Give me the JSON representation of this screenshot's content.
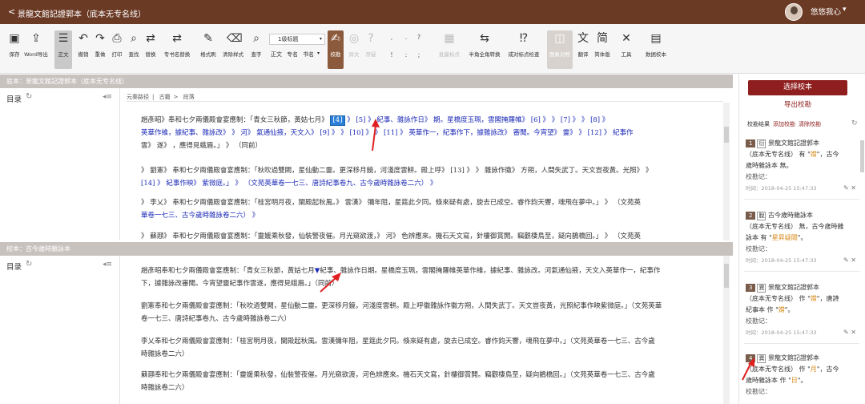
{
  "titlebar": {
    "back": "<",
    "title": "景龍文館記證郭本（底本无专名线）",
    "user": "悠悠我心",
    "caret": "▾"
  },
  "toolbar": {
    "buttons": [
      {
        "label": "保存",
        "icon": "save-icon",
        "glyph": "▣"
      },
      {
        "label": "Word导出",
        "icon": "word-export-icon",
        "glyph": "⇪"
      },
      {
        "label": "正文",
        "icon": "text-icon",
        "glyph": "☰"
      },
      {
        "label": "撤销",
        "icon": "undo-icon",
        "glyph": "↶"
      },
      {
        "label": "重做",
        "icon": "redo-icon",
        "glyph": "↷"
      },
      {
        "label": "打印",
        "icon": "print-icon",
        "glyph": "⎙"
      },
      {
        "label": "查找",
        "icon": "find-icon",
        "glyph": "⌕"
      },
      {
        "label": "替换",
        "icon": "replace-icon",
        "glyph": "⇄"
      },
      {
        "label": "专书名替换",
        "icon": "book-replace-icon",
        "glyph": "⇄"
      },
      {
        "label": "格式刷",
        "icon": "format-brush-icon",
        "glyph": "✎"
      },
      {
        "label": "清除样式",
        "icon": "clear-style-icon",
        "glyph": "⌫"
      },
      {
        "label": "查字",
        "icon": "lookup-char-icon",
        "glyph": "⌕"
      },
      {
        "label": "校勘",
        "icon": "collate-icon",
        "glyph": "✍"
      },
      {
        "label": "异文",
        "icon": "variant-icon",
        "glyph": "◎"
      },
      {
        "label": "存疑",
        "icon": "doubt-icon",
        "glyph": "?"
      },
      {
        "label": "批量标点",
        "icon": "batch-punct-icon",
        "glyph": "▦"
      },
      {
        "label": "半角全角转换",
        "icon": "width-convert-icon",
        "glyph": "⇆"
      },
      {
        "label": "成对标点检查",
        "icon": "pair-punct-icon",
        "glyph": "⁉"
      },
      {
        "label": "图象对照",
        "icon": "image-compare-icon",
        "glyph": "◫"
      },
      {
        "label": "翻译",
        "icon": "translate-icon",
        "glyph": "文"
      },
      {
        "label": "简体版",
        "icon": "simplified-icon",
        "glyph": "简"
      },
      {
        "label": "工具",
        "icon": "tools-icon",
        "glyph": "✕"
      },
      {
        "label": "数据校本",
        "icon": "data-collate-icon",
        "glyph": "▤"
      }
    ],
    "heading_select": "1级标题",
    "format_labels": [
      "正文",
      "专名",
      "书名"
    ]
  },
  "top_panel": {
    "head": "底本：景龍文館記證郭本（底本无专名线）",
    "toc_label": "目录",
    "breadcrumb": [
      "元秦路径",
      "古籍",
      "段落"
    ],
    "paras": [
      {
        "l1": "趙彥昭》奉和七夕兩儀殿會宴應制：「青女三秋節，黃姑七月》",
        "mark4": "[4]",
        "l1b": "》 [5] 》 紀事、雜詠作日》 期。星橋度玉珮，雲閣掩羅帷》 [6] 》 》 [7] 》 》 [8] 》",
        "l2": "英華作維，據紀事、雜詠改》 》 河》 氣通仙掖，天文入》 [9] 》 》 [10] 》 》 [11] 》 英華作一，紀事作下，據雜詠改》 審聞。今宵望》 靈》 》 [12] 》 紀事作",
        "l3": "雲》 遂》 ，應得見蛾眉。」 》 （同前）"
      },
      {
        "l1": "》 劉憲》 奉和七夕兩儀殿會宴應制：「秋吹過雙闕，星仙動二靈。更深移月鏡，河淺度雲軿。殿上呼》 [13] 》 》 雜詠作徽》 方朔，人間失武丁。天文豈夜黃。光照》 》",
        "l2": "[14] 》 紀事作映》 紫微庭。」 》 （文苑英華卷一七三、唐詩紀事卷九、古今歲時雜詠卷二六） 》"
      },
      {
        "l1": "》 李乂》 奉和七夕兩儀殿會宴應制：「桂宮明月夜，闌殿起秋風。》 雲漢》 彌年阻，星筵此夕同。倏來疑有處，旋去已成空。睿作鈞天響，魂飛在夢中。」 》 （文苑英",
        "l2": "華卷一七三、古今歲時雜詠卷二六） 》"
      },
      {
        "l1": "》 蘇頲》 奉和七夕兩儀殿會宴應制：「靈媛乘秋發，仙裝警夜催。月光窺欲渡，》 河》 色辨應來。機石天文寫，針樓御賞開。竊觀棲鳥至，疑向鵲橋回。」 》 （文苑英"
      }
    ]
  },
  "bottom_panel": {
    "head": "校本：古今歲時雜詠本",
    "toc_label": "目录",
    "paras": [
      {
        "l1": "趙彥昭奉和七夕兩儀殿會宴應制：「青女三秋節，黃姑七月",
        "l1b": "紀事、雜詠作日期。星橋度玉珮，雲閣掩羅帷英華作維，據紀事、雜詠改。河氣通仙掖，天文入英華作一，紀事作",
        "l2": "下，據雜詠改審聞。今宵望靈紀事作雲遂，應得見蛾眉。」（同前）"
      },
      {
        "l1": "劉憲奉和七夕兩儀殿會宴應制：「秋吹過雙闕，星仙動二靈。更深移月鏡，河淺度雲軿。殿上呼徽雜詠作徽方朔，人間失武丁。天文豈夜黃，光照紀事作映紫微庭。」（文苑英華",
        "l2": "卷一七三、唐詩紀事卷九、古今歲時雜詠卷二六）"
      },
      {
        "l1": "李乂奉和七夕兩儀殿會宴應制：「桂宮明月夜，闌殿起秋風。雲漢彌年阻，星筵此夕同。倏來疑有處，旋去已成空。睿作鈞天響，魂飛在夢中。」（文苑英華卷一七三、古今歲",
        "l2": "時雜詠卷二六）"
      },
      {
        "l1": "蘇頲奉和七夕兩儀殿會宴應制：「靈媛乘秋發，仙裝警夜催。月光窺欲渡，河色辨應來。機石天文寫，針樓御賞開。竊觀棲鳥至，疑向鵲橋回。」（文苑英華卷一七三、古今歲",
        "l2": "時雜詠卷二六）"
      }
    ]
  },
  "right_panel": {
    "select_button": "选择校本",
    "export_link": "导出校勘",
    "tabs": [
      "校勘结果",
      "添加校勘",
      "清除校勘"
    ],
    "cards": [
      {
        "num": "1",
        "type": "衍",
        "t1": "景龍文館記證郭本",
        "t2": "（底本无专名线） 有 \"",
        "hl": "嫦",
        "t3": "\"，古今",
        "t4": "歲時雜詠本 無。",
        "note": "校勘记：",
        "time": "时间：2018-04-25 15:47:33"
      },
      {
        "num": "2",
        "type": "脫",
        "t1": "古今歲時雜詠本",
        "t2": "（底本无专名线） 無，古今歲時雜",
        "t3": "詠本 有 \"",
        "hl": "星昇疑闕",
        "t4": "\"。",
        "note": "校勘记：",
        "time": "时间：2018-04-25 15:47:33"
      },
      {
        "num": "3",
        "type": "異",
        "t1": "景龍文館記證郭本",
        "t2": "（底本无专名线） 作 \"",
        "hl": "嫦",
        "t3": "\"，唐詩",
        "t4": "紀事本 作 \"",
        "hl2": "嫦",
        "t5": "\"。",
        "note": "校勘记：",
        "time": "时间：2018-04-25 15:47:33"
      },
      {
        "num": "4",
        "type": "異",
        "t1": "景龍文館記證郭本",
        "t2": "（底本无专名线） 作 \"",
        "hl": "月",
        "t3": "\"，古今",
        "t4": "歲時雜詠本 作 \"",
        "hl2": "日",
        "t5": "\"。",
        "note": "校勘记："
      }
    ]
  },
  "colors": {
    "title_bg": "#6b3a25",
    "accent": "#8f1f1f",
    "mark_blue": "#2a7fd8",
    "link_blue": "#1d2bb7",
    "arrow_red": "#e02020"
  }
}
